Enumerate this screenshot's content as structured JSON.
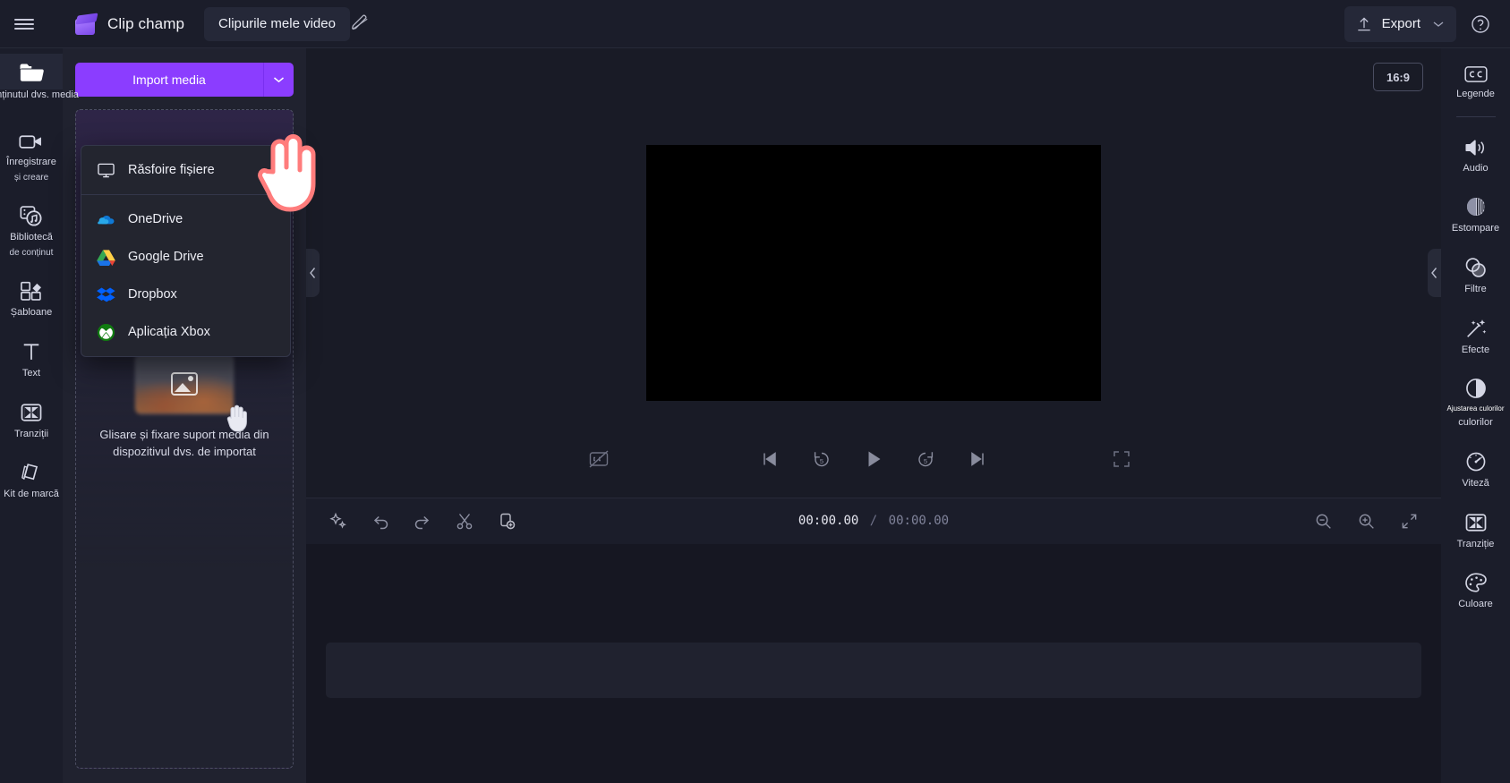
{
  "app": {
    "brand_name": "Clip champ",
    "project_tab": "Clipurile mele video",
    "menu_icon": "hamburger-icon",
    "edit_icon": "pencil-icon"
  },
  "topbar": {
    "export_label": "Export",
    "export_icon": "upload-icon",
    "export_caret": "⌄",
    "help_icon": "question-circle-icon"
  },
  "left_rail": {
    "items": [
      {
        "id": "media",
        "label": "Conținutul dvs. media",
        "sub": "",
        "icon": "folder-icon",
        "active": true
      },
      {
        "id": "record",
        "label": "Înregistrare",
        "sub": "și creare",
        "icon": "video-camera-icon",
        "active": false
      },
      {
        "id": "library",
        "label": "Bibliotecă",
        "sub": "de conținut",
        "icon": "content-library-icon",
        "active": false
      },
      {
        "id": "templates",
        "label": "Șabloane",
        "sub": "",
        "icon": "templates-icon",
        "active": false
      },
      {
        "id": "text",
        "label": "Text",
        "sub": "",
        "icon": "text-icon",
        "active": false
      },
      {
        "id": "transitions",
        "label": "Tranziții",
        "sub": "",
        "icon": "transitions-icon",
        "active": false
      },
      {
        "id": "brandkit",
        "label": "Kit de marcă",
        "sub": "",
        "icon": "brand-kit-icon",
        "active": false
      }
    ]
  },
  "media_panel": {
    "import_button_label": "Import media",
    "import_caret_icon": "chevron-down-icon",
    "dropzone_text": "Glisare și fixare suport media din dispozitivul dvs. de importat",
    "dropzone_thumb_icon": "image-icon",
    "grab_cursor_icon": "grab-hand-icon",
    "accent_color": "#8b3dff"
  },
  "import_dropdown": {
    "items": [
      {
        "id": "browse",
        "label": "Răsfoire fișiere",
        "icon": "monitor-icon"
      },
      {
        "id": "onedrive",
        "label": "OneDrive",
        "icon": "onedrive-icon"
      },
      {
        "id": "googledrive",
        "label": "Google Drive",
        "icon": "google-drive-icon"
      },
      {
        "id": "dropbox",
        "label": "Dropbox",
        "icon": "dropbox-icon"
      },
      {
        "id": "xbox",
        "label": "Aplicația Xbox",
        "icon": "xbox-icon"
      }
    ]
  },
  "preview": {
    "aspect_ratio": "16:9",
    "collapse_left_icon": "chevron-left-icon",
    "collapse_right_icon": "chevron-left-icon"
  },
  "player_controls": {
    "captions_icon": "captions-off-icon",
    "skip_start_icon": "skip-to-start-icon",
    "back5_icon": "rewind-5-icon",
    "play_icon": "play-icon",
    "forward5_icon": "forward-5-icon",
    "skip_end_icon": "skip-to-end-icon",
    "fullscreen_icon": "fullscreen-icon",
    "back5_label": "5",
    "forward5_label": "5"
  },
  "timeline": {
    "tools": [
      {
        "id": "magic",
        "icon": "sparkle-icon"
      },
      {
        "id": "undo",
        "icon": "undo-icon"
      },
      {
        "id": "redo",
        "icon": "redo-icon"
      },
      {
        "id": "split",
        "icon": "scissors-icon"
      },
      {
        "id": "duplicate",
        "icon": "duplicate-add-icon"
      }
    ],
    "current_time": "00:00.00",
    "separator": "/",
    "total_time": "00:00.00",
    "zoom_out_icon": "zoom-out-icon",
    "zoom_in_icon": "zoom-in-icon",
    "fit_icon": "fit-to-screen-icon"
  },
  "right_rail": {
    "items": [
      {
        "id": "captions",
        "label": "Legende",
        "icon": "cc-icon"
      },
      {
        "id": "audio",
        "label": "Audio",
        "icon": "speaker-icon"
      },
      {
        "id": "fade",
        "label": "Estompare",
        "icon": "fade-icon"
      },
      {
        "id": "filters",
        "label": "Filtre",
        "icon": "filters-icon"
      },
      {
        "id": "effects",
        "label": "Efecte",
        "icon": "magic-wand-icon"
      },
      {
        "id": "coloradjust",
        "label": "culorilor",
        "sub": "Ajustarea culorilor",
        "icon": "contrast-icon"
      },
      {
        "id": "speed",
        "label": "Viteză",
        "icon": "speedometer-icon"
      },
      {
        "id": "transition",
        "label": "Tranziție",
        "icon": "transitions-icon"
      },
      {
        "id": "color",
        "label": "Culoare",
        "icon": "palette-icon"
      }
    ]
  }
}
